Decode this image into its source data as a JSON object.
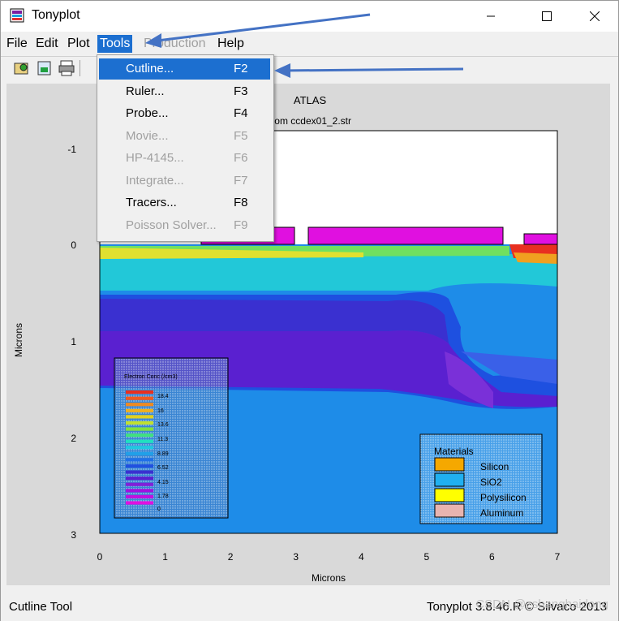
{
  "window": {
    "title": "Tonyplot"
  },
  "menubar": [
    {
      "label": "File",
      "state": "normal"
    },
    {
      "label": "Edit",
      "state": "normal"
    },
    {
      "label": "Plot",
      "state": "normal"
    },
    {
      "label": "Tools",
      "state": "active"
    },
    {
      "label": "Production",
      "state": "disabled"
    },
    {
      "label": "Help",
      "state": "normal"
    }
  ],
  "tools_menu": [
    {
      "label": "Cutline...",
      "shortcut": "F2",
      "state": "selected"
    },
    {
      "label": "Ruler...",
      "shortcut": "F3",
      "state": "normal"
    },
    {
      "label": "Probe...",
      "shortcut": "F4",
      "state": "normal"
    },
    {
      "label": "Movie...",
      "shortcut": "F5",
      "state": "disabled"
    },
    {
      "label": "HP-4145...",
      "shortcut": "F6",
      "state": "disabled"
    },
    {
      "label": "Integrate...",
      "shortcut": "F7",
      "state": "disabled"
    },
    {
      "label": "Tracers...",
      "shortcut": "F8",
      "state": "normal"
    },
    {
      "label": "Poisson Solver...",
      "shortcut": "F9",
      "state": "disabled"
    }
  ],
  "plot": {
    "title": "ATLAS",
    "subtitle": "from ccdex01_2.str",
    "xlabel": "Microns",
    "ylabel": "Microns",
    "x_ticks": [
      "0",
      "1",
      "2",
      "3",
      "4",
      "5",
      "6",
      "7"
    ],
    "y_ticks": [
      "-1",
      "0",
      "1",
      "2",
      "3"
    ],
    "x_range": [
      0,
      7
    ],
    "y_range": [
      -1.5,
      3
    ]
  },
  "contour_legend": {
    "title": "Electron Conc (/cm3)",
    "values": [
      "18.4",
      "16",
      "13.6",
      "11.3",
      "8.89",
      "6.52",
      "4.15",
      "1.78",
      "0"
    ]
  },
  "materials_legend": {
    "title": "Materials",
    "items": [
      {
        "label": "Silicon",
        "color": "#f5a800"
      },
      {
        "label": "SiO2",
        "color": "#20b0f0"
      },
      {
        "label": "Polysilicon",
        "color": "#ffff00"
      },
      {
        "label": "Aluminum",
        "color": "#e8b4b0"
      }
    ]
  },
  "status": {
    "left": "Cutline Tool",
    "right": "Tonyplot 3.8.46.R © Silvaco 2013"
  },
  "watermark": "CSDN @zshanghaidong"
}
